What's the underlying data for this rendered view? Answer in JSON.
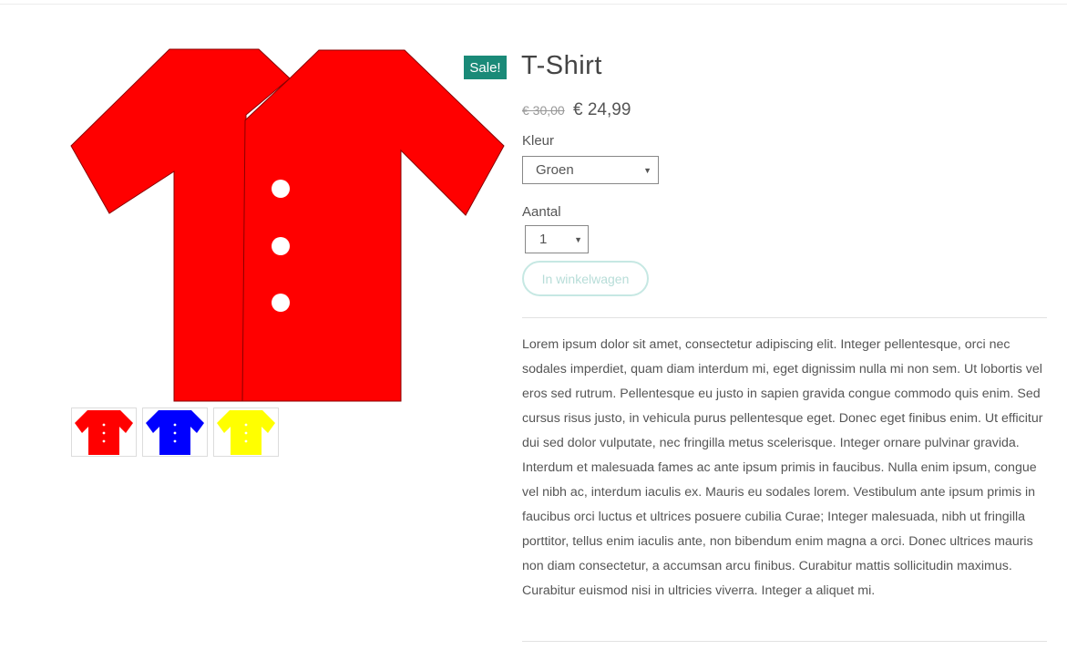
{
  "product": {
    "title": "T-Shirt",
    "sale_badge": "Sale!",
    "old_price": "€ 30,00",
    "price": "€ 24,99"
  },
  "form": {
    "color_label": "Kleur",
    "color_selected": "Groen",
    "quantity_label": "Aantal",
    "quantity_selected": "1",
    "add_to_cart_label": "In winkelwagen"
  },
  "gallery": {
    "main_image_icon": "shirt-icon",
    "main_color": "#ff0000",
    "thumbnails": [
      {
        "icon": "shirt-icon",
        "color": "#ff0000"
      },
      {
        "icon": "shirt-icon",
        "color": "#0000ff"
      },
      {
        "icon": "shirt-icon",
        "color": "#ffff00"
      }
    ]
  },
  "description": {
    "paragraph_1": "Lorem ipsum dolor sit amet, consectetur adipiscing elit. Integer pellentesque, orci nec sodales imperdiet, quam diam interdum mi, eget dignissim nulla mi non sem. Ut lobortis vel eros sed rutrum. Pellentesque eu justo in sapien gravida congue commodo quis enim. Sed cursus risus justo, in vehicula purus pellentesque eget. Donec eget finibus enim. Ut efficitur dui sed dolor vulputate, nec fringilla metus scelerisque. Integer ornare pulvinar gravida.",
    "paragraph_2": "Interdum et malesuada fames ac ante ipsum primis in faucibus. Nulla enim ipsum, congue vel nibh ac, interdum iaculis ex. Mauris eu sodales lorem. Vestibulum ante ipsum primis in faucibus orci luctus et ultrices posuere cubilia Curae; Integer malesuada, nibh ut fringilla porttitor, tellus enim iaculis ante, non bibendum enim magna a orci. Donec ultrices mauris non diam consectetur, a accumsan arcu finibus. Curabitur mattis sollicitudin maximus. Curabitur euismod nisi in ultricies viverra. Integer a aliquet mi."
  },
  "colors": {
    "accent": "#1a8a78",
    "button_border": "#c6e8e3"
  }
}
